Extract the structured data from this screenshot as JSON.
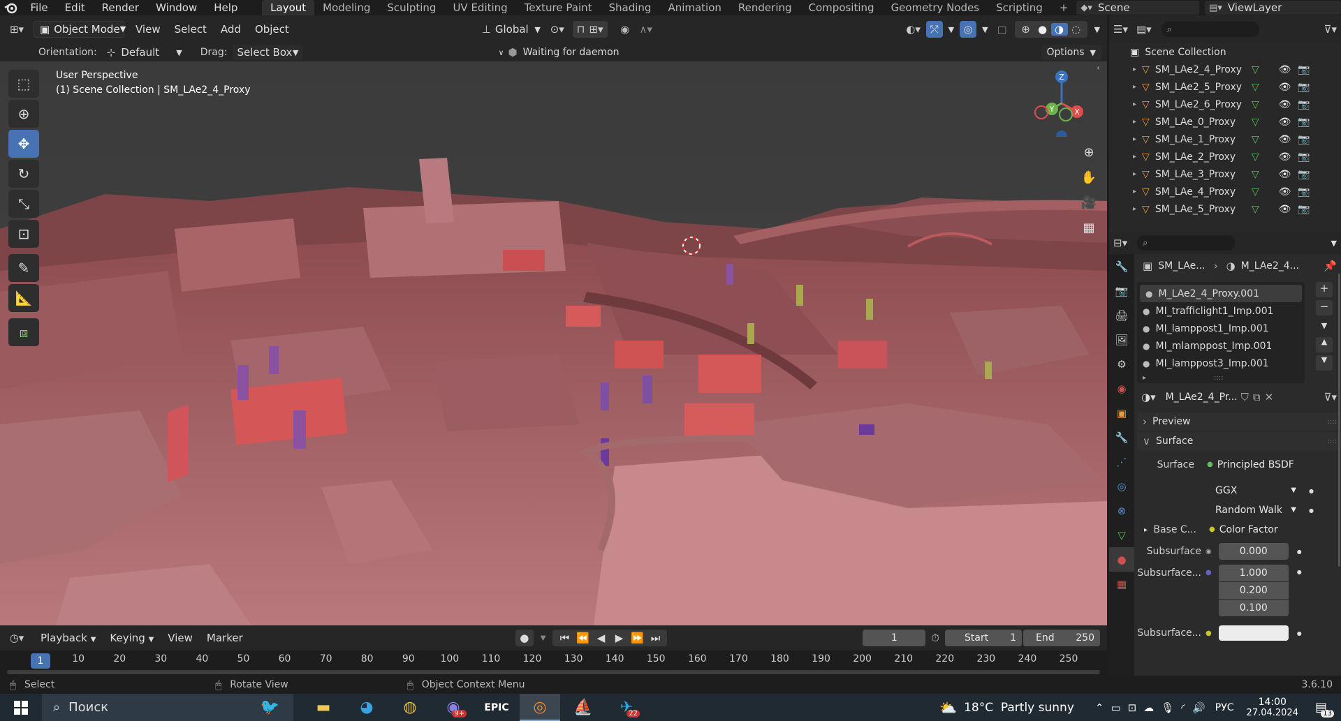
{
  "topbar": {
    "menus": [
      "File",
      "Edit",
      "Render",
      "Window",
      "Help"
    ],
    "workspaces": [
      "Layout",
      "Modeling",
      "Sculpting",
      "UV Editing",
      "Texture Paint",
      "Shading",
      "Animation",
      "Rendering",
      "Compositing",
      "Geometry Nodes",
      "Scripting"
    ],
    "active_workspace": "Layout",
    "scene": "Scene",
    "view_layer": "ViewLayer"
  },
  "viewport_header": {
    "mode": "Object Mode",
    "menus": [
      "View",
      "Select",
      "Add",
      "Object"
    ],
    "transform_orientation": "Global",
    "orientation_label": "Orientation:",
    "orientation_value": "Default",
    "drag_label": "Drag:",
    "drag_value": "Select Box",
    "status": "Waiting for daemon",
    "options": "Options"
  },
  "viewport": {
    "perspective": "User Perspective",
    "collection_info": "(1) Scene Collection | SM_LAe2_4_Proxy",
    "gizmo_axes": [
      "X",
      "Y",
      "Z"
    ]
  },
  "outliner": {
    "root": "Scene Collection",
    "items": [
      "SM_LAe2_4_Proxy",
      "SM_LAe2_5_Proxy",
      "SM_LAe2_6_Proxy",
      "SM_LAe_0_Proxy",
      "SM_LAe_1_Proxy",
      "SM_LAe_2_Proxy",
      "SM_LAe_3_Proxy",
      "SM_LAe_4_Proxy",
      "SM_LAe_5_Proxy"
    ]
  },
  "properties": {
    "breadcrumb_object": "SM_LAe...",
    "breadcrumb_material": "M_LAe2_4...",
    "material_slots": [
      "M_LAe2_4_Proxy.001",
      "MI_trafficlight1_Imp.001",
      "MI_lamppost1_Imp.001",
      "MI_mlamppost_Imp.001",
      "MI_lamppost3_Imp.001"
    ],
    "active_material": "M_LAe2_4_Pr...",
    "panels": {
      "preview": "Preview",
      "surface": "Surface"
    },
    "surface_label": "Surface",
    "surface_value": "Principled BSDF",
    "distribution": "GGX",
    "subsurface_method": "Random Walk",
    "base_color_label": "Base C...",
    "base_color_value": "Color Factor",
    "subsurface_label": "Subsurface",
    "subsurface_value": "0.000",
    "subsurface_radius_label": "Subsurface...",
    "subsurface_radius": [
      "1.000",
      "0.200",
      "0.100"
    ],
    "subsurface_color_label": "Subsurface...",
    "subsurface_color": "#ececec"
  },
  "timeline": {
    "menus": [
      "Playback",
      "Keying",
      "View",
      "Marker"
    ],
    "current_frame": "1",
    "start_label": "Start",
    "start": "1",
    "end_label": "End",
    "end": "250",
    "ruler_current": "1",
    "ruler_ticks": [
      "10",
      "20",
      "30",
      "40",
      "50",
      "60",
      "70",
      "80",
      "90",
      "100",
      "110",
      "120",
      "130",
      "140",
      "150",
      "160",
      "170",
      "180",
      "190",
      "200",
      "210",
      "220",
      "230",
      "240",
      "250"
    ]
  },
  "statusbar": {
    "select": "Select",
    "rotate": "Rotate View",
    "context": "Object Context Menu",
    "version": "3.6.10"
  },
  "taskbar": {
    "search_placeholder": "Поиск",
    "weather": "18°C  Partly sunny",
    "language": "РУС",
    "time": "14:00",
    "date": "27.04.2024",
    "notifications": "13",
    "edge_badge": "9+",
    "telegram_badge": "22"
  }
}
